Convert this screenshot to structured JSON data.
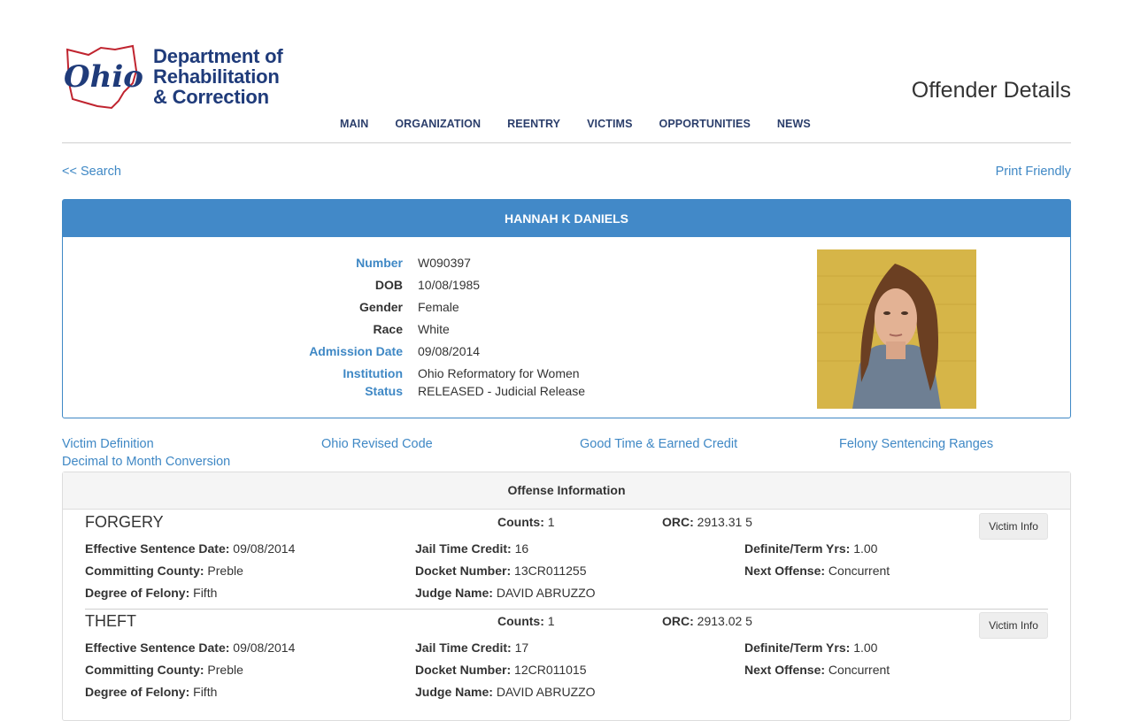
{
  "header": {
    "logo_script": "Ohio",
    "logo_line1": "Department of",
    "logo_line2": "Rehabilitation",
    "logo_line3": "& Correction",
    "page_title": "Offender Details",
    "nav": [
      "MAIN",
      "ORGANIZATION",
      "REENTRY",
      "VICTIMS",
      "OPPORTUNITIES",
      "NEWS"
    ]
  },
  "links": {
    "search": "<< Search",
    "print": "Print Friendly"
  },
  "offender": {
    "name": "HANNAH K DANIELS",
    "labels": {
      "number": "Number",
      "dob": "DOB",
      "gender": "Gender",
      "race": "Race",
      "admission": "Admission Date",
      "institution": "Institution",
      "status": "Status"
    },
    "number": "W090397",
    "dob": "10/08/1985",
    "gender": "Female",
    "race": "White",
    "admission": "09/08/2014",
    "institution": "Ohio Reformatory for Women",
    "status": "RELEASED - Judicial Release"
  },
  "reference_links": [
    "Victim Definition",
    "Ohio Revised Code",
    "Good Time & Earned Credit",
    "Felony Sentencing Ranges",
    "Decimal to Month Conversion"
  ],
  "offense_panel": {
    "title": "Offense Information",
    "labels": {
      "counts": "Counts:",
      "orc": "ORC:",
      "effective": "Effective Sentence Date:",
      "jail": "Jail Time Credit:",
      "definite": "Definite/Term Yrs:",
      "county": "Committing County:",
      "docket": "Docket Number:",
      "next": "Next Offense:",
      "degree": "Degree of Felony:",
      "judge": "Judge Name:"
    },
    "victim_button": "Victim Info",
    "offenses": [
      {
        "name": "FORGERY",
        "counts": "1",
        "orc": "2913.31 5",
        "effective": "09/08/2014",
        "jail": "16",
        "definite": "1.00",
        "county": "Preble",
        "docket": "13CR011255",
        "next": "Concurrent",
        "degree": "Fifth",
        "judge": "DAVID ABRUZZO"
      },
      {
        "name": "THEFT",
        "counts": "1",
        "orc": "2913.02 5",
        "effective": "09/08/2014",
        "jail": "17",
        "definite": "1.00",
        "county": "Preble",
        "docket": "12CR011015",
        "next": "Concurrent",
        "degree": "Fifth",
        "judge": "DAVID ABRUZZO"
      }
    ]
  }
}
